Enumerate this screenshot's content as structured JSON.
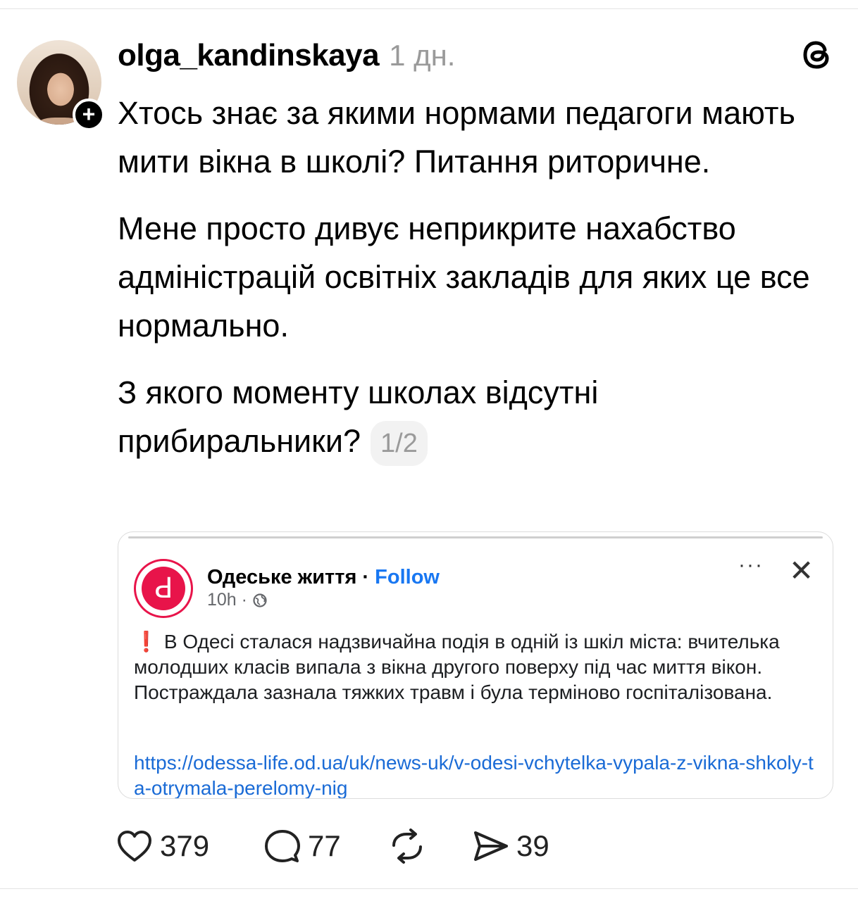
{
  "post": {
    "username": "olga_kandinskaya",
    "timestamp": "1 дн.",
    "follow_symbol": "+",
    "paragraphs": [
      "Хтось знає за якими нормами педагоги мають мити вікна в школі? Питання риторичне.",
      "Мене просто дивує неприкрите нахабство адміністрацій освітніх закладів для яких це все нормально.",
      "З якого моменту школах відсутні прибиральники?"
    ],
    "page_indicator": "1/2"
  },
  "embed": {
    "page_name": "Одеське життя",
    "separator": " · ",
    "follow_label": "Follow",
    "time": "10h · ",
    "more_label": "···",
    "close_label": "✕",
    "logo_letter": "Ԁ",
    "exclamation": "❗",
    "text": "В Одесі сталася надзвичайна подія в одній із шкіл міста: вчителька молодших класів випала з вікна другого поверху під час миття вікон. Постраждала зазнала тяжких травм і була терміново госпіталізована.",
    "link": "https://odessa-life.od.ua/uk/news-uk/v-odesi-vchytelka-vypala-z-vikna-shkoly-ta-otrymala-perelomy-nig"
  },
  "actions": {
    "likes": "379",
    "replies": "77",
    "shares": "39"
  },
  "icons": [
    "threads-icon",
    "heart-icon",
    "comment-icon",
    "repost-icon",
    "share-icon",
    "globe-icon"
  ]
}
